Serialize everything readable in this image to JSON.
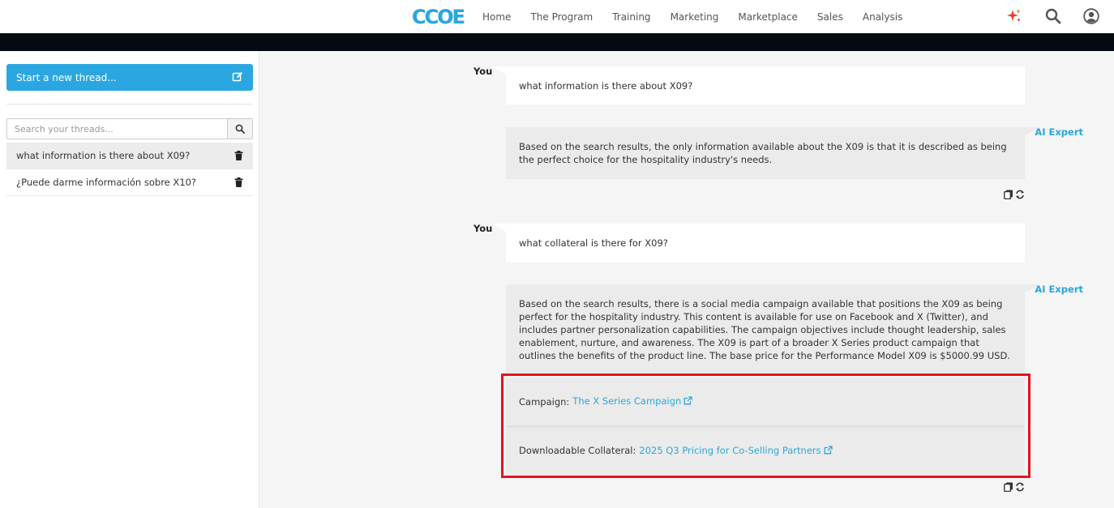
{
  "header": {
    "logo_text": "CCOE",
    "nav": [
      "Home",
      "The Program",
      "Training",
      "Marketing",
      "Marketplace",
      "Sales",
      "Analysis"
    ],
    "icons": [
      "sparkle-icon",
      "search-icon",
      "user-account-icon"
    ],
    "sparkle_color": "#e8412c"
  },
  "sidebar": {
    "new_thread_label": "Start a new thread...",
    "search_placeholder": "Search your threads...",
    "threads": [
      "what information is there about X09?",
      "¿Puede darme información sobre X10?"
    ]
  },
  "chat": {
    "user_label": "You",
    "ai_label": "AI Expert",
    "messages": [
      {
        "role": "user",
        "text": "what information is there about X09?"
      },
      {
        "role": "ai",
        "text": "Based on the search results, the only information available about the X09 is that it is described as being the perfect choice for the hospitality industry's needs."
      },
      {
        "role": "user",
        "text": "what collateral is there for X09?"
      },
      {
        "role": "ai",
        "text": "Based on the search results, there is a social media campaign available that positions the X09 as being perfect for the hospitality industry. This content is available for use on Facebook and X (Twitter), and includes partner personalization capabilities. The campaign objectives include thought leadership, sales enablement, nurture, and awareness. The X09 is part of a broader X Series product campaign that outlines the benefits of the product line. The base price for the Performance Model X09 is $5000.99 USD.",
        "links": [
          {
            "prefix": "Campaign:",
            "label": "The X Series Campaign"
          },
          {
            "prefix": "Downloadable Collateral:",
            "label": "2025 Q3 Pricing for Co-Selling Partners"
          }
        ]
      }
    ]
  },
  "colors": {
    "accent": "#2aa7e0",
    "highlight": "#e3141f"
  }
}
